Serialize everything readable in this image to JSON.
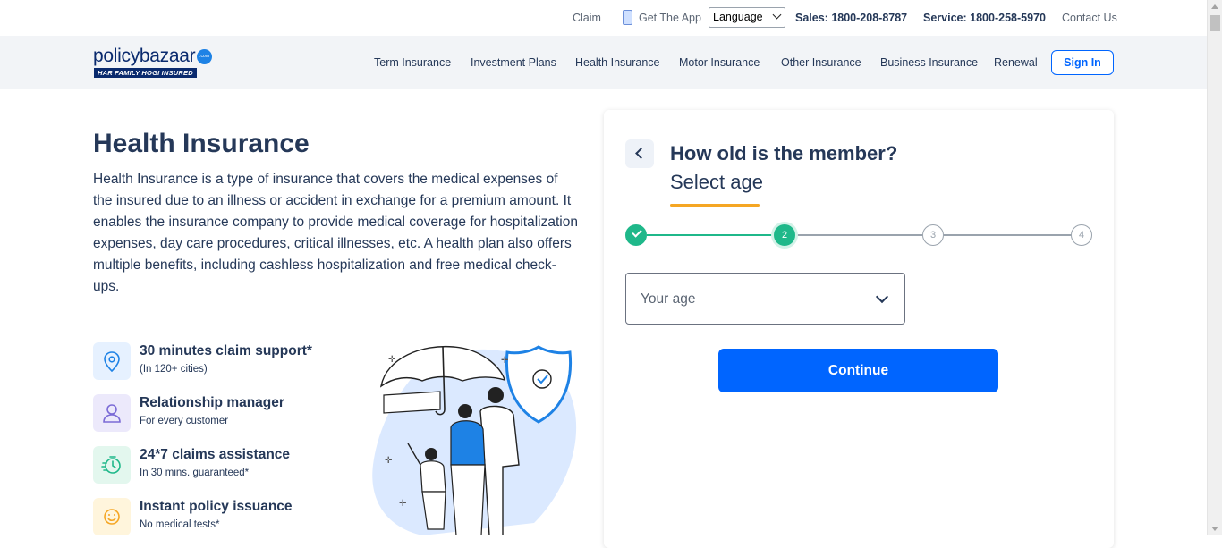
{
  "topbar": {
    "claim": "Claim",
    "get_app": "Get The App",
    "language": "Language",
    "sales_label": "Sales:",
    "sales_number": "1800-208-8787",
    "service_label": "Service:",
    "service_number": "1800-258-5970",
    "contact": "Contact Us"
  },
  "logo": {
    "name": "policybazaar",
    "suffix": ".com",
    "tagline": "HAR FAMILY HOGI INSURED"
  },
  "nav": {
    "items": [
      "Term Insurance",
      "Investment Plans",
      "Health Insurance",
      "Motor Insurance",
      "Other Insurance",
      "Business Insurance",
      "Renewal"
    ],
    "signin": "Sign In"
  },
  "hero": {
    "title": "Health Insurance",
    "description": "Health Insurance is a type of insurance that covers the medical expenses of the insured due to an illness or accident in exchange for a premium amount. It enables the insurance company to provide medical coverage for hospitalization expenses, day care procedures, critical illnesses, etc. A health plan also offers multiple benefits, including cashless hospitalization and free medical check-ups."
  },
  "features": [
    {
      "title": "30 minutes claim support*",
      "sub": "(In 120+ cities)",
      "icon": "location-pin-icon",
      "bg": "#e6f1ff"
    },
    {
      "title": "Relationship manager",
      "sub": "For every customer",
      "icon": "person-icon",
      "bg": "#ece9fb"
    },
    {
      "title": "24*7 claims assistance",
      "sub": "In 30 mins. guaranteed*",
      "icon": "stopwatch-icon",
      "bg": "#e3f7ee"
    },
    {
      "title": "Instant policy issuance",
      "sub": "No medical tests*",
      "icon": "smiley-icon",
      "bg": "#fff5dc"
    }
  ],
  "form": {
    "question": "How old is the member?",
    "subtitle": "Select age",
    "steps": [
      "1",
      "2",
      "3",
      "4"
    ],
    "current_step": 2,
    "age_placeholder": "Your age",
    "continue": "Continue"
  },
  "colors": {
    "primary": "#0065ff",
    "text": "#253858",
    "success": "#1fb88a",
    "accent": "#f5a623"
  }
}
